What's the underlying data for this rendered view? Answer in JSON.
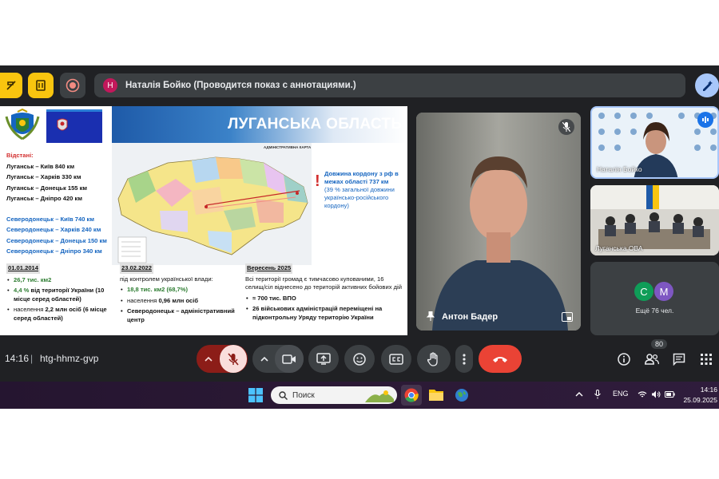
{
  "banner": {
    "avatar_letter": "Н",
    "text": "Наталія Бойко (Проводится показ с аннотациями.)"
  },
  "slide": {
    "title": "ЛУГАНСЬКА ОБЛАСТЬ",
    "map_label": "АДМІНІСТРАТИВНА КАРТА",
    "distances_label": "Відстані:",
    "distances_luhansk": [
      "Луганськ – Київ 840 км",
      "Луганськ – Харків 330 км",
      "Луганськ – Донецьк 155 км",
      "Луганськ – Дніпро 420 км"
    ],
    "distances_sever": [
      "Северодонецьк – Київ 740 км",
      "Северодонецьк – Харків 240 км",
      "Северодонецьк – Донецьк 150 км",
      "Северодонецьк – Дніпро  340 км"
    ],
    "border_note_1": "Довжина кордону з рф в межах області 737 км",
    "border_note_2": "(39  % загальної довжини українсько-російського кордону)",
    "col1": {
      "date": "01.01.2014",
      "items": [
        {
          "a": "26,7 тис. км2",
          "b": ""
        },
        {
          "a": "4,4 % ",
          "b": "від території України (10 місце серед областей)"
        },
        {
          "a": "населення ",
          "b": "2,2 млн осіб (6 місце серед областей)"
        }
      ]
    },
    "col2": {
      "date": "23.02.2022",
      "intro": "під контролем української влади:",
      "items": [
        {
          "a": "18,8 тис. км2 (68,7%)",
          "b": ""
        },
        {
          "a": "населення ",
          "b": "0,96 млн осіб"
        },
        {
          "a": "Северодонецьк – адміністративний центр",
          "b": ""
        }
      ]
    },
    "col3": {
      "date": "Вересень 2025",
      "intro": "Всі території громад є тимчасово купованими, 16 селищ/сіл віднесено до територій активних бойових дій",
      "items": [
        {
          "a": "≈ 700 тис. ВПО",
          "b": ""
        },
        {
          "a": "26 військових адміністрацій переміщені на підконтрольну Уряду територію України",
          "b": ""
        }
      ]
    }
  },
  "tiles": {
    "anton": {
      "name": "Антон Бадер"
    },
    "natalia": {
      "name": "Наталія Бойко"
    },
    "luhansk": {
      "name": "Луганська ОВА"
    },
    "more": {
      "av1": "С",
      "av2": "М",
      "text": "Ещё 76 чел."
    }
  },
  "bottom": {
    "time": "14:16",
    "separator": "|",
    "code": "htg-hhmz-gvp",
    "participants_badge": "80"
  },
  "taskbar": {
    "search_placeholder": "Поиск",
    "lang": "ENG",
    "time": "14:16",
    "date": "25.09.2025"
  },
  "colors": {
    "meet_bg": "#202124",
    "leave": "#ea4335",
    "accent_yellow": "#f9c50f"
  }
}
